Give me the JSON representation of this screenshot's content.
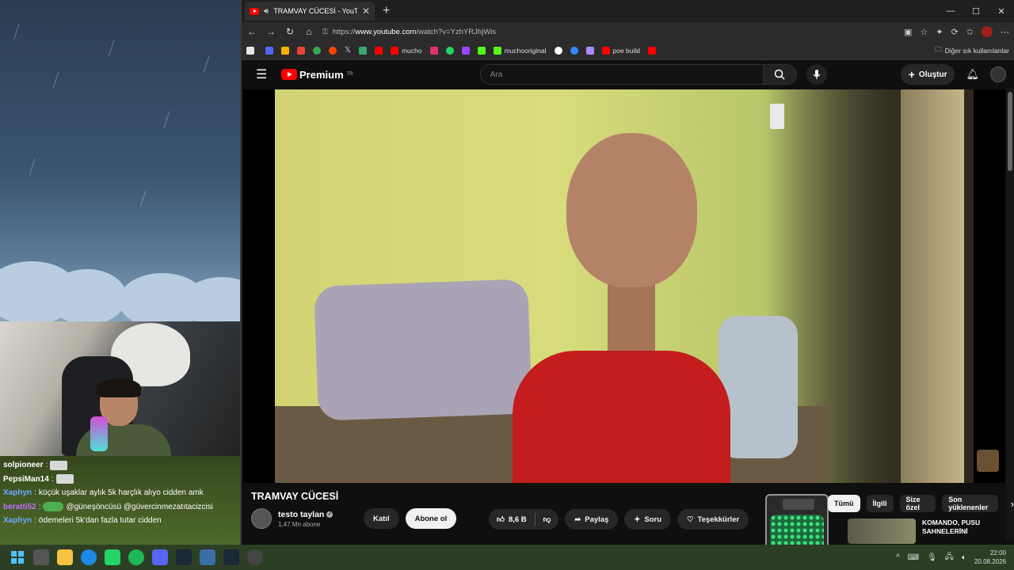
{
  "chat": {
    "lines": [
      {
        "user": "solpioneer",
        "sep": ":",
        "msg": "",
        "color": "#ffffff"
      },
      {
        "user": "PepsiMan14",
        "sep": ":",
        "msg": "",
        "color": "#ffffff"
      },
      {
        "user": "Xaphyn",
        "sep": ":",
        "msg": "küçük uşaklar aylık 5k harçlık alıyo cidden amk",
        "color": "#6fa8ff"
      },
      {
        "user": "beratti52",
        "sep": ":",
        "msg": "@güneşöncüsü @güvercinmezatıtacizcisi",
        "color": "#c070ff"
      },
      {
        "user": "Xaphyn",
        "sep": ":",
        "msg": "ödemeleri 5k'dan fazla tutar cidden",
        "color": "#6fa8ff"
      }
    ]
  },
  "browser": {
    "tab_title": "TRAMVAY CÜCESİ - YouTube",
    "url_prefix": "https://",
    "url_host": "www.youtube.com",
    "url_path": "/watch?v=YzhYRJhjWis",
    "bookmarks": [
      {
        "label": "",
        "color": "#e8e8e8"
      },
      {
        "label": "",
        "color": "#5865f2"
      },
      {
        "label": "",
        "color": "#f4b400"
      },
      {
        "label": "",
        "color": "#ea4335"
      },
      {
        "label": "",
        "color": "#34a853"
      },
      {
        "label": "",
        "color": "#ff4500"
      },
      {
        "label": "",
        "color": "#ffffff"
      },
      {
        "label": "",
        "color": "#3aa76d"
      },
      {
        "label": "",
        "color": "#ff0000"
      },
      {
        "label": "mucho",
        "color": "#ff0000"
      },
      {
        "label": "",
        "color": "#e1306c"
      },
      {
        "label": "",
        "color": "#25d366"
      },
      {
        "label": "",
        "color": "#9146ff"
      },
      {
        "label": "",
        "color": "#53fc18"
      },
      {
        "label": "muchooriginal",
        "color": "#53fc18"
      },
      {
        "label": "",
        "color": "#ffffff"
      },
      {
        "label": "",
        "color": "#2d8cff"
      },
      {
        "label": "",
        "color": "#a88bff"
      },
      {
        "label": "poe build",
        "color": "#ff0000"
      },
      {
        "label": "",
        "color": "#ff0000"
      }
    ],
    "other_bookmarks": "Diğer sık kullanılanlar"
  },
  "youtube": {
    "logo_text": "Premium",
    "region": "TR",
    "search_placeholder": "Ara",
    "create_label": "Oluştur",
    "video_title": "TRAMVAY CÜCESİ",
    "channel_name": "testo taylan",
    "subscribers": "1,47 Mn abone",
    "join_label": "Katıl",
    "subscribe_label": "Abone ol",
    "likes": "8,6 B",
    "share_label": "Paylaş",
    "ask_label": "Soru",
    "thanks_label": "Teşekkürler",
    "chips": [
      "Tümü",
      "İlgili",
      "Size özel",
      "Son yüklenenler"
    ],
    "related_title": "KOMANDO, PUSU SAHNELERİNİ"
  },
  "taskbar": {
    "time": "22:00",
    "date": "20.08.2026"
  }
}
